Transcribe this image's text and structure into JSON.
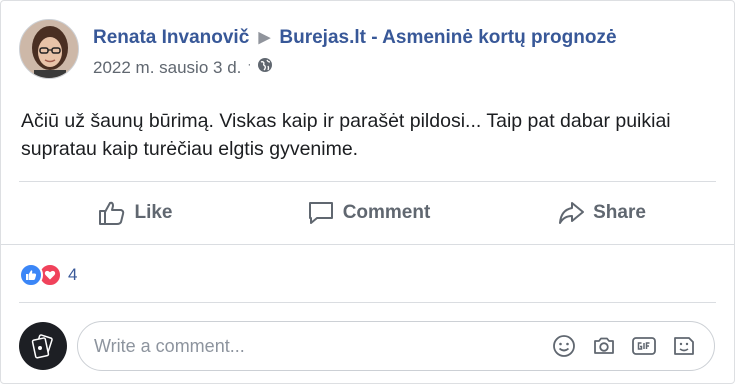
{
  "post": {
    "author": "Renata Invanovič",
    "target_page": "Burejas.lt - Asmeninė kortų prognozė",
    "date": "2022 m. sausio 3 d.",
    "separator": "·",
    "privacy_icon": "globe-icon",
    "text": "Ačiū už šaunų būrimą. Viskas kaip ir parašėt pildosi... Taip pat dabar puikiai supratau kaip turėčiau elgtis gyvenime."
  },
  "actions": {
    "like_label": "Like",
    "comment_label": "Comment",
    "share_label": "Share"
  },
  "reactions": {
    "types": [
      "like-icon",
      "love-icon"
    ],
    "count": "4"
  },
  "composer": {
    "placeholder": "Write a comment...",
    "tools": [
      "emoji-icon",
      "camera-icon",
      "gif-icon",
      "sticker-icon"
    ]
  },
  "colors": {
    "link_blue": "#385898",
    "secondary_text": "#606770",
    "like_blue": "#3b86f7",
    "love_red": "#f0425b"
  }
}
